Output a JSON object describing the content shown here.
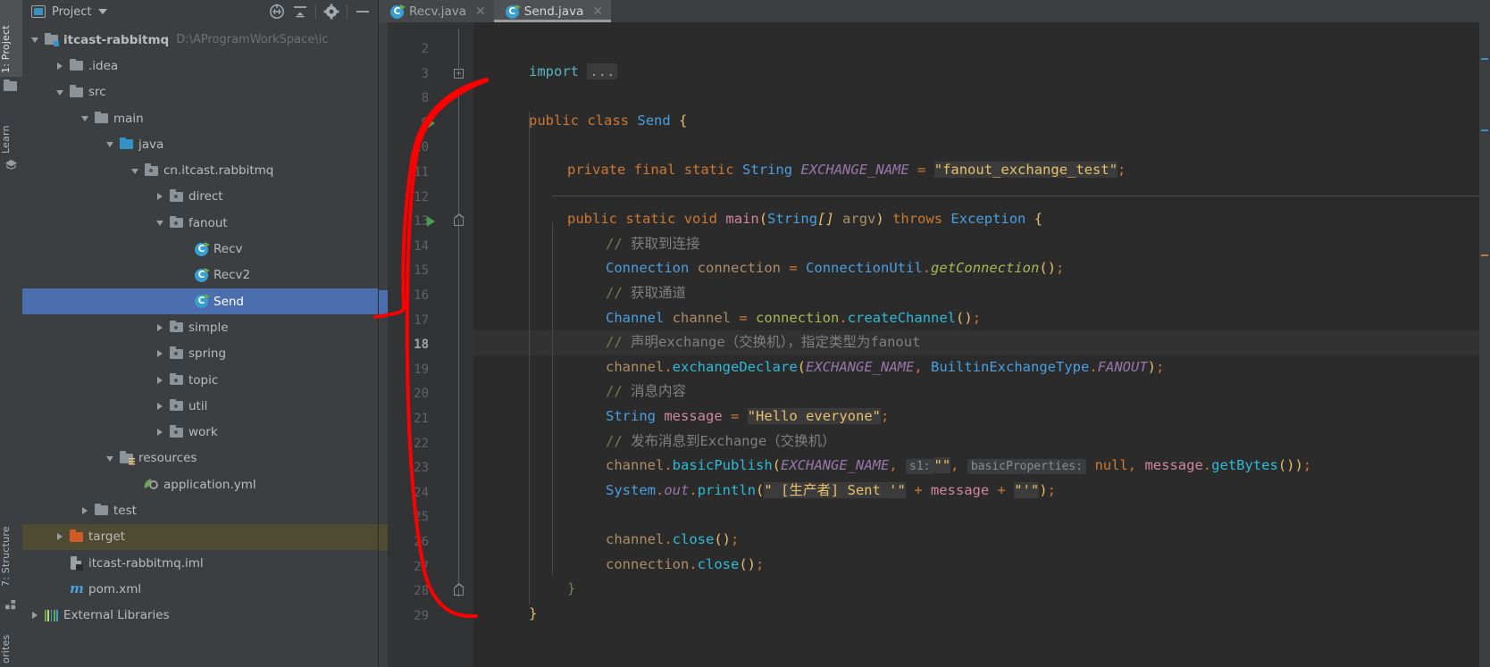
{
  "window": {
    "ide": "IntelliJ IDEA",
    "theme_bg": "#2b2b2b",
    "panel_bg": "#3c3f41",
    "selection_blue": "#4b6eaf",
    "target_olive": "#4f4b32",
    "annotation_color": "#ff0000"
  },
  "left_strip": {
    "tabs": [
      {
        "label": "1: Project",
        "icon": "project-folder-icon",
        "active": true
      },
      {
        "label": "Learn",
        "icon": "graduation-cap-icon",
        "active": false
      },
      {
        "label": "7: Structure",
        "icon": "structure-icon",
        "active": false
      },
      {
        "label": "orites",
        "icon": "favorites-icon",
        "active": false
      }
    ]
  },
  "project_panel": {
    "title": "Project",
    "title_icon": "project-panel-icon",
    "dropdown_icon": "chevron-down-icon",
    "toolbar_icons": [
      "locate-target-icon",
      "collapse-all-icon",
      "settings-gear-icon",
      "hide-minimize-icon"
    ],
    "tree": [
      {
        "label": "itcast-rabbitmq",
        "hint": "D:\\AProgramWorkSpace\\ic",
        "depth": 0,
        "arrow": "down",
        "icon": "module-folder-icon",
        "bold": true
      },
      {
        "label": ".idea",
        "hint": "",
        "depth": 1,
        "arrow": "right",
        "icon": "folder-icon"
      },
      {
        "label": "src",
        "hint": "",
        "depth": 1,
        "arrow": "down",
        "icon": "folder-icon"
      },
      {
        "label": "main",
        "hint": "",
        "depth": 2,
        "arrow": "down",
        "icon": "folder-icon"
      },
      {
        "label": "java",
        "hint": "",
        "depth": 3,
        "arrow": "down",
        "icon": "source-root-folder-icon"
      },
      {
        "label": "cn.itcast.rabbitmq",
        "hint": "",
        "depth": 4,
        "arrow": "down",
        "icon": "package-icon"
      },
      {
        "label": "direct",
        "hint": "",
        "depth": 5,
        "arrow": "right",
        "icon": "package-icon"
      },
      {
        "label": "fanout",
        "hint": "",
        "depth": 5,
        "arrow": "down",
        "icon": "package-icon"
      },
      {
        "label": "Recv",
        "hint": "",
        "depth": 6,
        "arrow": "none",
        "icon": "java-class-runnable-icon"
      },
      {
        "label": "Recv2",
        "hint": "",
        "depth": 6,
        "arrow": "none",
        "icon": "java-class-runnable-icon"
      },
      {
        "label": "Send",
        "hint": "",
        "depth": 6,
        "arrow": "none",
        "icon": "java-class-runnable-icon",
        "selected": true
      },
      {
        "label": "simple",
        "hint": "",
        "depth": 5,
        "arrow": "right",
        "icon": "package-icon"
      },
      {
        "label": "spring",
        "hint": "",
        "depth": 5,
        "arrow": "right",
        "icon": "package-icon"
      },
      {
        "label": "topic",
        "hint": "",
        "depth": 5,
        "arrow": "right",
        "icon": "package-icon"
      },
      {
        "label": "util",
        "hint": "",
        "depth": 5,
        "arrow": "right",
        "icon": "package-icon"
      },
      {
        "label": "work",
        "hint": "",
        "depth": 5,
        "arrow": "right",
        "icon": "package-icon"
      },
      {
        "label": "resources",
        "hint": "",
        "depth": 3,
        "arrow": "down",
        "icon": "resources-folder-icon"
      },
      {
        "label": "application.yml",
        "hint": "",
        "depth": 4,
        "arrow": "none",
        "icon": "yaml-file-icon"
      },
      {
        "label": "test",
        "hint": "",
        "depth": 2,
        "arrow": "right",
        "icon": "folder-icon"
      },
      {
        "label": "target",
        "hint": "",
        "depth": 1,
        "arrow": "right",
        "icon": "excluded-folder-icon",
        "target": true
      },
      {
        "label": "itcast-rabbitmq.iml",
        "hint": "",
        "depth": 1,
        "arrow": "none",
        "icon": "iml-file-icon"
      },
      {
        "label": "pom.xml",
        "hint": "",
        "depth": 1,
        "arrow": "none",
        "icon": "maven-pom-icon"
      },
      {
        "label": "External Libraries",
        "hint": "",
        "depth": 0,
        "arrow": "right",
        "icon": "libraries-icon"
      }
    ]
  },
  "editor": {
    "tabs": [
      {
        "label": "Recv.java",
        "icon": "java-class-runnable-icon",
        "close_icon": "close-icon",
        "active": false
      },
      {
        "label": "Send.java",
        "icon": "java-class-runnable-icon",
        "close_icon": "close-icon",
        "active": true
      }
    ],
    "current_line": 18,
    "line_numbers": [
      2,
      3,
      8,
      9,
      10,
      11,
      12,
      13,
      14,
      15,
      16,
      17,
      18,
      19,
      20,
      21,
      22,
      23,
      24,
      25,
      26,
      27,
      28,
      29
    ],
    "lines": {
      "l3_import": "import",
      "l3_folded": "...",
      "l9": {
        "mod": "public",
        "kw": "class",
        "name": "Send",
        "brace": "{"
      },
      "l11": {
        "mods": "private final static",
        "type": "String",
        "field": "EXCHANGE_NAME",
        "eq": "=",
        "value": "\"fanout_exchange_test\"",
        "semi": ";"
      },
      "l13": {
        "mods": "public static void",
        "name": "main",
        "params": "(String[] argv)",
        "throws": "throws Exception {"
      },
      "l14_comment": "// 获取到连接",
      "l15": "Connection connection = ConnectionUtil.getConnection();",
      "l16_comment": "// 获取通道",
      "l17": "Channel channel = connection.createChannel();",
      "l18_comment": "// 声明exchange（交换机），指定类型为fanout",
      "l19": "channel.exchangeDeclare(EXCHANGE_NAME, BuiltinExchangeType.FANOUT);",
      "l20_comment": "// 消息内容",
      "l21": "String message = \"Hello everyone\";",
      "l22_comment": "// 发布消息到Exchange（交换机）",
      "l23": "channel.basicPublish(EXCHANGE_NAME, s1: \"\", basicProperties: null, message.getBytes());",
      "l23_hint_s1": "s1:",
      "l23_hint_props": "basicProperties:",
      "l24": "System.out.println(\" [生产者] Sent '\" + message + \"'\");",
      "l26": "channel.close();",
      "l27": "connection.close();",
      "l28": "}",
      "l29": "}"
    }
  }
}
